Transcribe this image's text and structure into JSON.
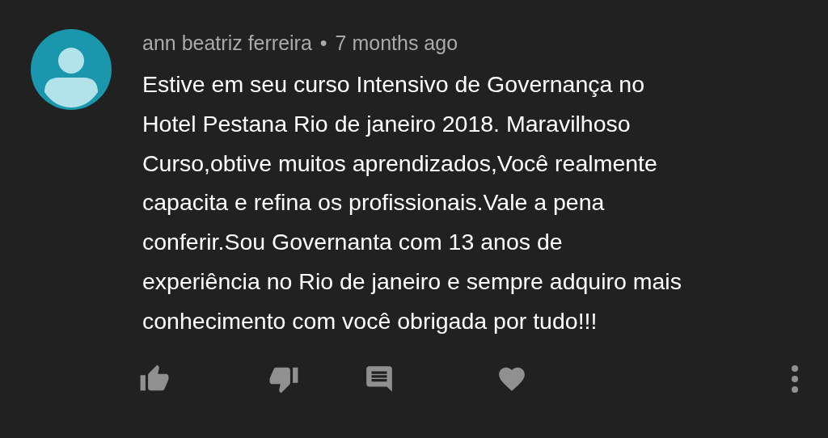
{
  "comment": {
    "author": "ann beatriz ferreira",
    "separator": "•",
    "time": "7 months ago",
    "body_lines": [
      "Estive em seu curso Intensivo de Governança no",
      "Hotel Pestana Rio de janeiro 2018. Maravilhoso",
      "Curso,obtive muitos aprendizados,Você realmente",
      "capacita e refina os profissionais.Vale a pena",
      "conferir.Sou Governanta com 13 anos de",
      "experiência no Rio de janeiro e sempre adquiro mais",
      "conhecimento com você obrigada por tudo!!!"
    ]
  }
}
